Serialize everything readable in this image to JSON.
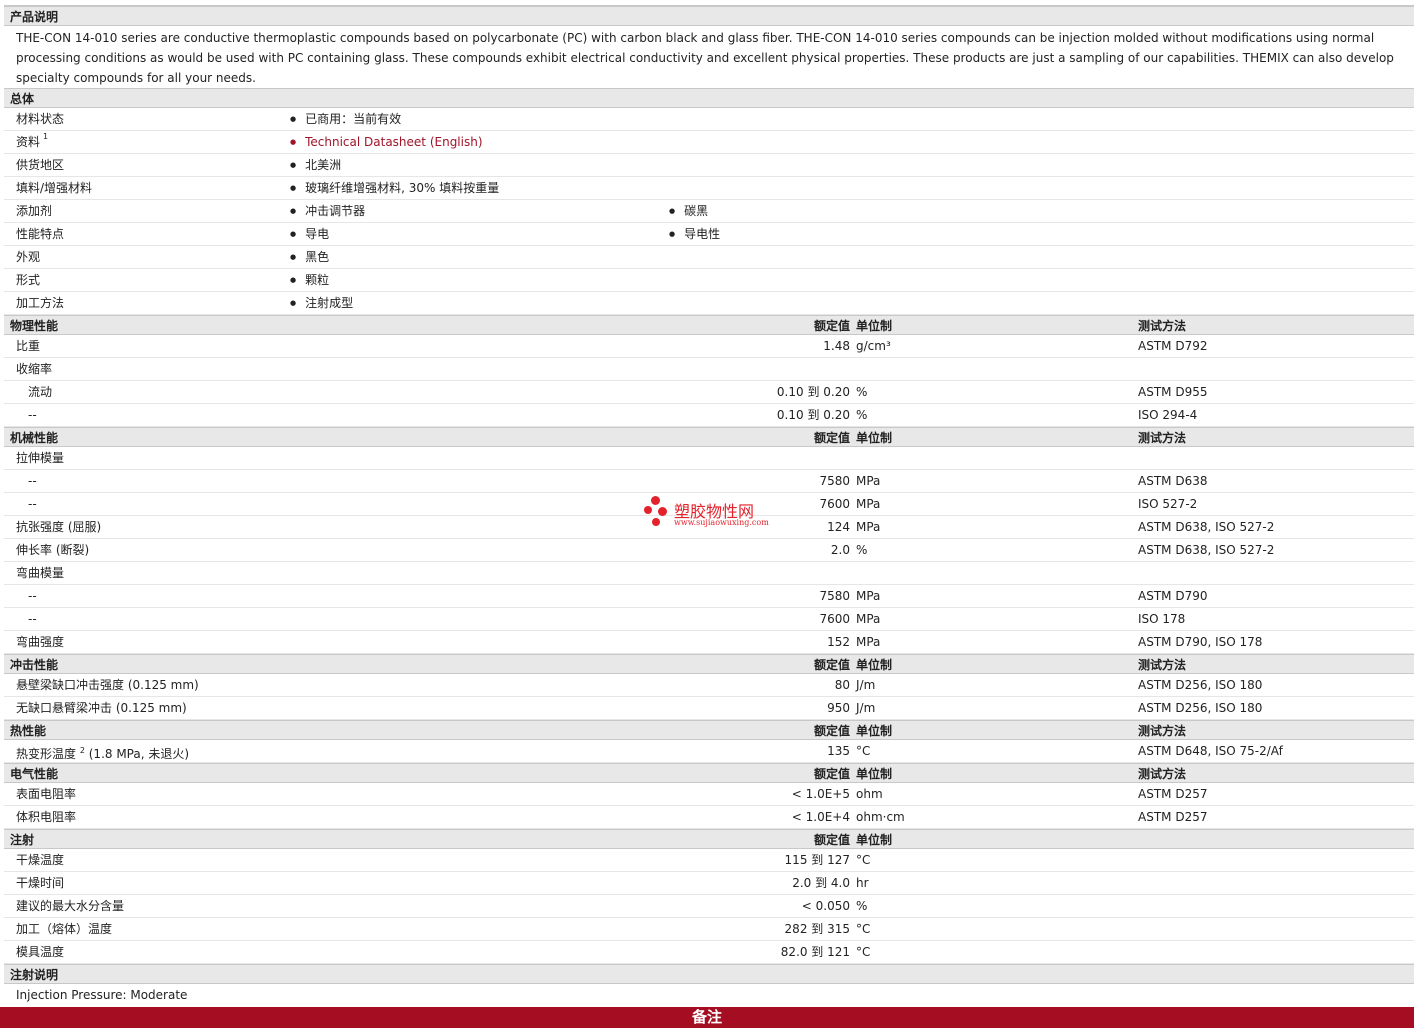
{
  "description": {
    "title": "产品说明",
    "text": "THE-CON 14-010 series are conductive thermoplastic compounds based on polycarbonate (PC) with carbon black and glass fiber. THE-CON 14-010 series compounds can be injection molded without modifications using normal processing conditions as would be used with PC containing glass. These compounds exhibit electrical conductivity and excellent physical properties. These products are just a sampling of our capabilities. THEMIX can also develop specialty compounds for all your needs."
  },
  "general": {
    "title": "总体",
    "rows": [
      {
        "label": "材料状态",
        "sup": "",
        "items": [
          "已商用：当前有效"
        ]
      },
      {
        "label": "资料",
        "sup": "1",
        "items": [
          "Technical Datasheet (English)"
        ],
        "link": true
      },
      {
        "label": "供货地区",
        "sup": "",
        "items": [
          "北美洲"
        ]
      },
      {
        "label": "填料/增强材料",
        "sup": "",
        "items": [
          "玻璃纤维增强材料, 30% 填料按重量"
        ]
      },
      {
        "label": "添加剂",
        "sup": "",
        "items": [
          "冲击调节器",
          "碳黑"
        ]
      },
      {
        "label": "性能特点",
        "sup": "",
        "items": [
          "导电",
          "导电性"
        ]
      },
      {
        "label": "外观",
        "sup": "",
        "items": [
          "黑色"
        ]
      },
      {
        "label": "形式",
        "sup": "",
        "items": [
          "颗粒"
        ]
      },
      {
        "label": "加工方法",
        "sup": "",
        "items": [
          "注射成型"
        ]
      }
    ]
  },
  "headers": {
    "value": "额定值",
    "unit": "单位制",
    "test": "测试方法"
  },
  "physical": {
    "title": "物理性能",
    "rows": [
      {
        "label": "比重",
        "indent": false,
        "value": "1.48",
        "unit": "g/cm³",
        "test": "ASTM D792"
      },
      {
        "label": "收缩率",
        "indent": false,
        "value": "",
        "unit": "",
        "test": ""
      },
      {
        "label": "流动",
        "indent": true,
        "value": "0.10 到  0.20",
        "unit": "%",
        "test": "ASTM D955"
      },
      {
        "label": "--",
        "indent": true,
        "value": "0.10 到  0.20",
        "unit": "%",
        "test": "ISO 294-4"
      }
    ]
  },
  "mechanical": {
    "title": "机械性能",
    "rows": [
      {
        "label": "拉伸模量",
        "indent": false,
        "value": "",
        "unit": "",
        "test": ""
      },
      {
        "label": "--",
        "indent": true,
        "value": "7580",
        "unit": "MPa",
        "test": "ASTM D638"
      },
      {
        "label": "--",
        "indent": true,
        "value": "7600",
        "unit": "MPa",
        "test": "ISO 527-2"
      },
      {
        "label": "抗张强度 (屈服)",
        "indent": false,
        "value": "124",
        "unit": "MPa",
        "test": "ASTM D638, ISO 527-2"
      },
      {
        "label": "伸长率 (断裂)",
        "indent": false,
        "value": "2.0",
        "unit": "%",
        "test": "ASTM D638, ISO 527-2"
      },
      {
        "label": "弯曲模量",
        "indent": false,
        "value": "",
        "unit": "",
        "test": ""
      },
      {
        "label": "--",
        "indent": true,
        "value": "7580",
        "unit": "MPa",
        "test": "ASTM D790"
      },
      {
        "label": "--",
        "indent": true,
        "value": "7600",
        "unit": "MPa",
        "test": "ISO 178"
      },
      {
        "label": "弯曲强度",
        "indent": false,
        "value": "152",
        "unit": "MPa",
        "test": "ASTM D790, ISO 178"
      }
    ]
  },
  "impact": {
    "title": "冲击性能",
    "rows": [
      {
        "label": "悬壁梁缺口冲击强度 (0.125 mm)",
        "indent": false,
        "value": "80",
        "unit": "J/m",
        "test": "ASTM D256, ISO 180"
      },
      {
        "label": "无缺口悬臂梁冲击 (0.125 mm)",
        "indent": false,
        "value": "950",
        "unit": "J/m",
        "test": "ASTM D256, ISO 180"
      }
    ]
  },
  "thermal": {
    "title": "热性能",
    "rows": [
      {
        "label": "热变形温度",
        "sup": "2",
        "suffix": " (1.8 MPa, 未退火)",
        "value": "135",
        "unit": "°C",
        "test": "ASTM D648, ISO 75-2/Af"
      }
    ]
  },
  "electrical": {
    "title": "电气性能",
    "rows": [
      {
        "label": "表面电阻率",
        "indent": false,
        "value": "< 1.0E+5",
        "unit": "ohm",
        "test": "ASTM D257"
      },
      {
        "label": "体积电阻率",
        "indent": false,
        "value": "< 1.0E+4",
        "unit": "ohm·cm",
        "test": "ASTM D257"
      }
    ]
  },
  "injection": {
    "title": "注射",
    "rows": [
      {
        "label": "干燥温度",
        "indent": false,
        "value": "115 到  127",
        "unit": "°C",
        "test": ""
      },
      {
        "label": "干燥时间",
        "indent": false,
        "value": "2.0 到  4.0",
        "unit": "hr",
        "test": ""
      },
      {
        "label": "建议的最大水分含量",
        "indent": false,
        "value": "< 0.050",
        "unit": "%",
        "test": ""
      },
      {
        "label": "加工（熔体）温度",
        "indent": false,
        "value": "282 到  315",
        "unit": "°C",
        "test": ""
      },
      {
        "label": "模具温度",
        "indent": false,
        "value": "82.0 到  121",
        "unit": "°C",
        "test": ""
      }
    ]
  },
  "injection_notes": {
    "title": "注射说明",
    "text": "Injection Pressure: Moderate"
  },
  "footer": {
    "label": "备注"
  },
  "watermark": {
    "name": "塑胶物性网",
    "url": "www.sujiaowuxing.com",
    "color": "#e4222c"
  },
  "colors": {
    "footer_bg": "#a50d22",
    "link": "#a0142a",
    "header_bg": "#e8e8e8"
  }
}
